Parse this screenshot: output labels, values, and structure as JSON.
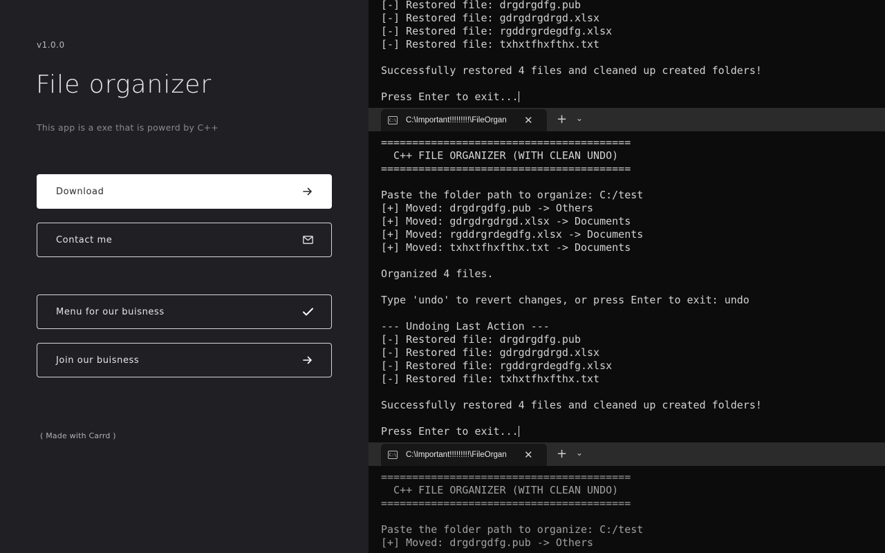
{
  "sidebar": {
    "version": "v1.0.0",
    "title": "File organizer",
    "subtitle": "This app is a exe that is powerd by C++",
    "buttons": [
      {
        "label": "Download",
        "icon": "arrow-right-icon"
      },
      {
        "label": "Contact me",
        "icon": "envelope-icon"
      },
      {
        "label": "Menu for our buisness",
        "icon": "checkmark-icon"
      },
      {
        "label": "Join our buisness",
        "icon": "arrow-right-icon"
      }
    ],
    "footer": "( Made with Carrd )"
  },
  "terminal": {
    "top_block": [
      "[-] Restored file: drgdrgdfg.pub",
      "[-] Restored file: gdrgdrgdrgd.xlsx",
      "[-] Restored file: rgddrgrdegdfg.xlsx",
      "[-] Restored file: txhxtfhxfthx.txt",
      "",
      "Successfully restored 4 files and cleaned up created folders!",
      "",
      "Press Enter to exit..."
    ],
    "tab_title": "C:\\Important!!!!!!!!!\\FileOrgan",
    "tab_icon_text": "C:\\",
    "tab_close": "✕",
    "tab_plus": "+",
    "tab_dropdown": "⌄",
    "middle_block": [
      "========================================",
      "  C++ FILE ORGANIZER (WITH CLEAN UNDO)",
      "========================================",
      "",
      "Paste the folder path to organize: C:/test",
      "[+] Moved: drgdrgdfg.pub -> Others",
      "[+] Moved: gdrgdrgdrgd.xlsx -> Documents",
      "[+] Moved: rgddrgrdegdfg.xlsx -> Documents",
      "[+] Moved: txhxtfhxfthx.txt -> Documents",
      "",
      "Organized 4 files.",
      "",
      "Type 'undo' to revert changes, or press Enter to exit: undo",
      "",
      "--- Undoing Last Action ---",
      "[-] Restored file: drgdrgdfg.pub",
      "[-] Restored file: gdrgdrgdrgd.xlsx",
      "[-] Restored file: rgddrgrdegdfg.xlsx",
      "[-] Restored file: txhxtfhxfthx.txt",
      "",
      "Successfully restored 4 files and cleaned up created folders!",
      "",
      "Press Enter to exit..."
    ],
    "bottom_block": [
      "========================================",
      "  C++ FILE ORGANIZER (WITH CLEAN UNDO)",
      "========================================",
      "",
      "Paste the folder path to organize: C:/test",
      "[+] Moved: drgdrgdfg.pub -> Others"
    ]
  },
  "colors": {
    "left_bg": "#1f1f24",
    "terminal_bg": "#0c0c0c",
    "primary_button_bg": "#ffffff",
    "terminal_text": "#d2d2d2"
  }
}
